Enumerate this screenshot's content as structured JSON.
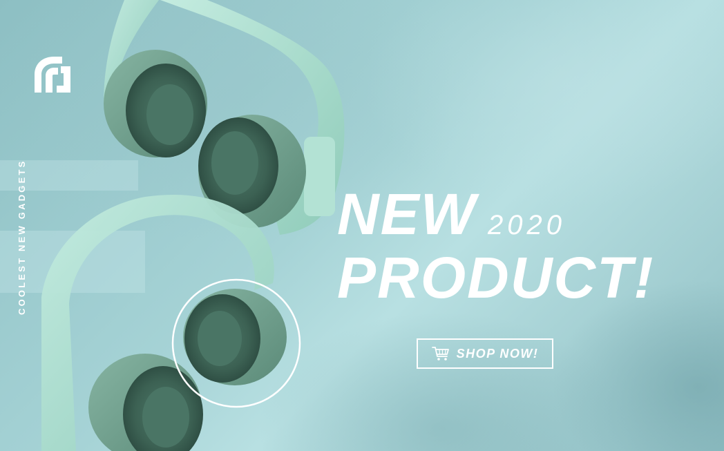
{
  "brand": {
    "logo_icon": "brand-logo-icon"
  },
  "side_tagline": "COOLEST NEW GADGETS",
  "headline": {
    "line1": "NEW",
    "year": "2020",
    "line2": "PRODUCT!"
  },
  "cta": {
    "label": "SHOP NOW!",
    "icon": "cart-icon"
  },
  "colors": {
    "background": "#a6d3d6",
    "headphone_body": "#a9dccb",
    "headphone_cup": "#6f9e8c",
    "ear_pad": "#3f6659",
    "text": "#ffffff"
  }
}
